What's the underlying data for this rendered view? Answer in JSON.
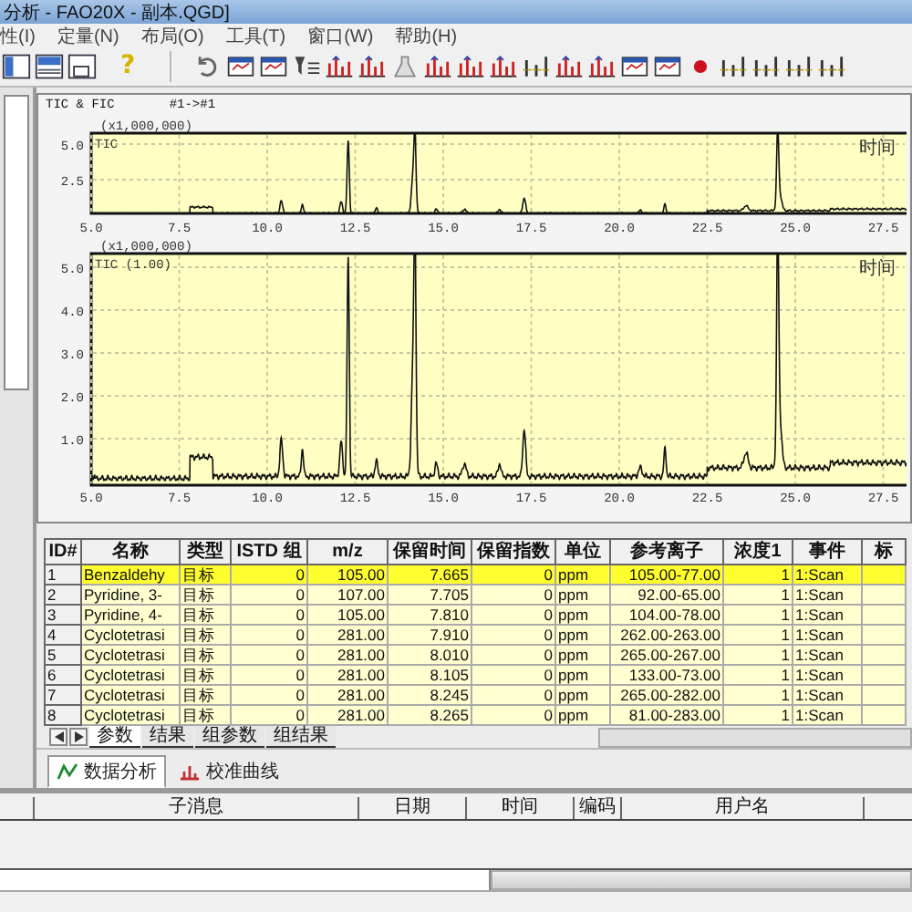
{
  "window": {
    "title": "分析 - FAO20X - 副本.QGD]"
  },
  "menu": [
    "性(I)",
    "定量(N)",
    "布局(O)",
    "工具(T)",
    "窗口(W)",
    "帮助(H)"
  ],
  "toolbar": {
    "help_glyph": "?"
  },
  "chart_panel": {
    "title": "TIC & FIC",
    "range": "#1->#1"
  },
  "charts": [
    {
      "scale": "(x1,000,000)",
      "trace_label": "TIC",
      "corner_label": "时间",
      "yticks": [
        "5.0",
        "2.5"
      ],
      "xticks": [
        "5.0",
        "7.5",
        "10.0",
        "12.5",
        "15.0",
        "17.5",
        "20.0",
        "22.5",
        "25.0",
        "27.5"
      ]
    },
    {
      "scale": "(x1,000,000)",
      "trace_label": "TIC (1.00)",
      "corner_label": "时间",
      "yticks": [
        "5.0",
        "4.0",
        "3.0",
        "2.0",
        "1.0"
      ],
      "xticks": [
        "5.0",
        "7.5",
        "10.0",
        "12.5",
        "15.0",
        "17.5",
        "20.0",
        "22.5",
        "25.0",
        "27.5"
      ]
    }
  ],
  "table": {
    "columns": [
      "ID#",
      "名称",
      "类型",
      "ISTD 组",
      "m/z",
      "保留时间",
      "保留指数",
      "单位",
      "参考离子",
      "浓度1",
      "事件",
      "标"
    ],
    "rows": [
      {
        "selected": true,
        "cells": [
          "1",
          "Benzaldehy",
          "目标",
          "0",
          "105.00",
          "7.665",
          "0",
          "ppm",
          "105.00-77.00",
          "1",
          "1:Scan"
        ]
      },
      {
        "selected": false,
        "cells": [
          "2",
          "Pyridine, 3-",
          "目标",
          "0",
          "107.00",
          "7.705",
          "0",
          "ppm",
          "92.00-65.00",
          "1",
          "1:Scan"
        ]
      },
      {
        "selected": false,
        "cells": [
          "3",
          "Pyridine, 4-",
          "目标",
          "0",
          "105.00",
          "7.810",
          "0",
          "ppm",
          "104.00-78.00",
          "1",
          "1:Scan"
        ]
      },
      {
        "selected": false,
        "cells": [
          "4",
          "Cyclotetrasi",
          "目标",
          "0",
          "281.00",
          "7.910",
          "0",
          "ppm",
          "262.00-263.00",
          "1",
          "1:Scan"
        ]
      },
      {
        "selected": false,
        "cells": [
          "5",
          "Cyclotetrasi",
          "目标",
          "0",
          "281.00",
          "8.010",
          "0",
          "ppm",
          "265.00-267.00",
          "1",
          "1:Scan"
        ]
      },
      {
        "selected": false,
        "cells": [
          "6",
          "Cyclotetrasi",
          "目标",
          "0",
          "281.00",
          "8.105",
          "0",
          "ppm",
          "133.00-73.00",
          "1",
          "1:Scan"
        ]
      },
      {
        "selected": false,
        "cells": [
          "7",
          "Cyclotetrasi",
          "目标",
          "0",
          "281.00",
          "8.245",
          "0",
          "ppm",
          "265.00-282.00",
          "1",
          "1:Scan"
        ]
      },
      {
        "selected": false,
        "cells": [
          "8",
          "Cyclotetrasi",
          "目标",
          "0",
          "281.00",
          "8.265",
          "0",
          "ppm",
          "81.00-283.00",
          "1",
          "1:Scan"
        ]
      }
    ]
  },
  "sheet_tabs": [
    {
      "label": "参数",
      "selected": true
    },
    {
      "label": "结果",
      "selected": false
    },
    {
      "label": "组参数",
      "selected": false
    },
    {
      "label": "组结果",
      "selected": false
    }
  ],
  "view_tabs": [
    {
      "label": "数据分析",
      "selected": true
    },
    {
      "label": "校准曲线",
      "selected": false
    }
  ],
  "log_table": {
    "columns": [
      "子消息",
      "日期",
      "时间",
      "编码",
      "用户名"
    ]
  }
}
